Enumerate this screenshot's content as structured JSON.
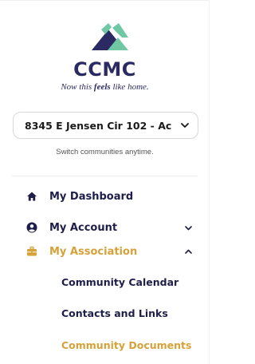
{
  "brand": {
    "logo_text": "CCMC",
    "tagline_pre": "Now this ",
    "tagline_bold": "feels",
    "tagline_post": " like home.",
    "colors": {
      "navy": "#2b2a63",
      "mint": "#6fc8a3",
      "gold": "#d5a23a"
    }
  },
  "community_selector": {
    "value": "8345 E Jensen Cir 102 - Ac",
    "icon": "chevron-down-icon",
    "note": "Switch communities anytime."
  },
  "nav": {
    "items": [
      {
        "label": "My Dashboard",
        "icon": "home-icon"
      },
      {
        "label": "My Account",
        "icon": "user-circle-icon",
        "caret": "chevron-down-icon"
      },
      {
        "label": "My Association",
        "icon": "briefcase-icon",
        "caret": "chevron-up-icon",
        "active": true
      }
    ],
    "sub_items": [
      {
        "label": "Community Calendar"
      },
      {
        "label": "Contacts and Links"
      },
      {
        "label": "Community Documents",
        "active": true
      }
    ]
  }
}
